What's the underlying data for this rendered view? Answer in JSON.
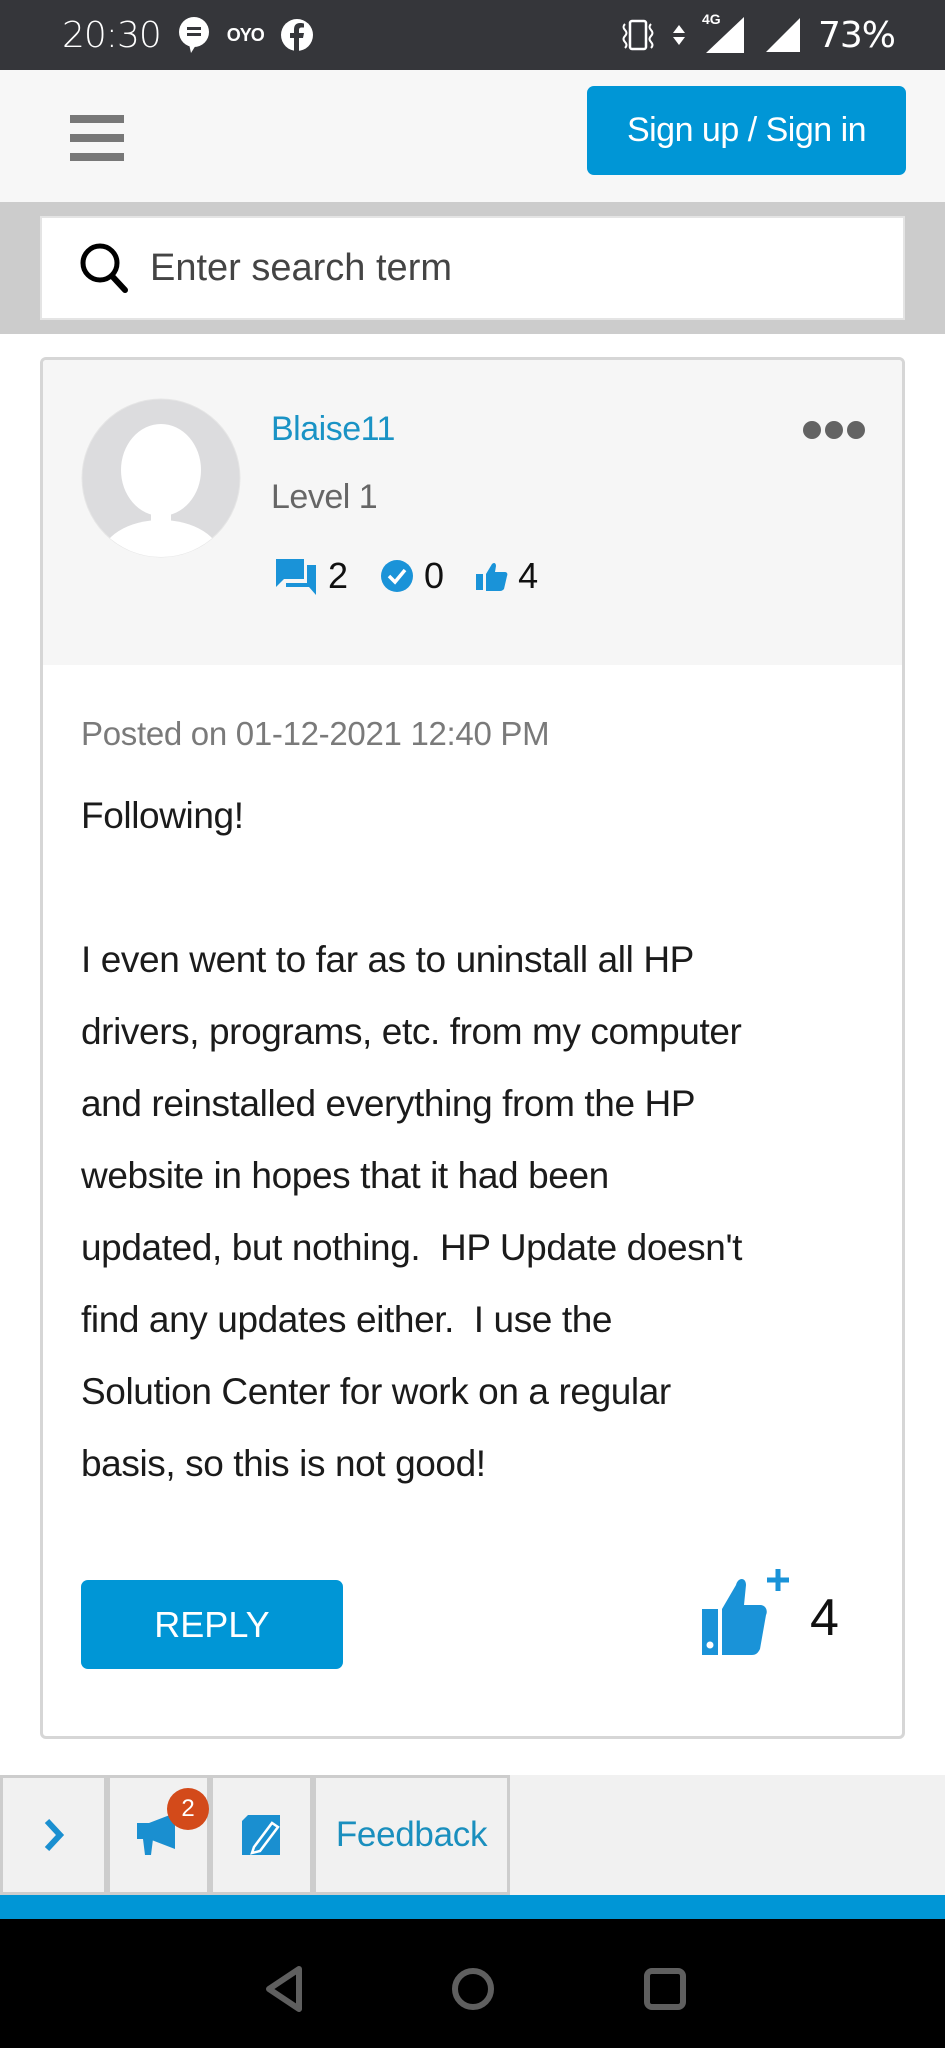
{
  "status_bar": {
    "time": "20:30",
    "notification_icons": [
      "chat-icon",
      "oyo-icon",
      "facebook-icon"
    ],
    "oyo_label": "OYO",
    "system_icons": [
      "vibrate-icon",
      "data-arrows-icon",
      "signal-4g-icon",
      "signal-icon"
    ],
    "network_label": "4G",
    "battery": "73%"
  },
  "header": {
    "menu_icon": "hamburger-icon",
    "signin_label": "Sign up / Sign in"
  },
  "search": {
    "icon": "search-icon",
    "placeholder": "Enter search term",
    "value": ""
  },
  "post": {
    "author": {
      "username": "Blaise11",
      "rank": "Level 1",
      "stats": [
        {
          "icon": "messages-icon",
          "value": "2"
        },
        {
          "icon": "solutions-icon",
          "value": "0"
        },
        {
          "icon": "kudos-icon",
          "value": "4"
        }
      ]
    },
    "menu_icon": "more-options-icon",
    "posted_on": "Posted on 01-12-2021 12:40 PM",
    "body": [
      "Following!",
      "",
      "I even went to far as to uninstall all HP",
      "drivers, programs, etc. from my computer",
      "and reinstalled everything from the HP",
      "website in hopes that it had been",
      "updated, but nothing.  HP Update doesn't",
      "find any updates either.  I use the",
      "Solution Center for work on a regular",
      "basis, so this is not good!"
    ],
    "reply_label": "REPLY",
    "kudos_count": "4"
  },
  "toolbar": {
    "expand_icon": "chevron-right-icon",
    "announcement_icon": "megaphone-icon",
    "announcement_badge": "2",
    "edit_icon": "edit-note-icon",
    "feedback_label": "Feedback"
  },
  "colors": {
    "accent": "#0096d6",
    "link": "#1a93c5",
    "badge": "#d34a1a",
    "status_bar": "#35363a"
  },
  "nav_bar": {
    "buttons": [
      "back-icon",
      "home-icon",
      "recents-icon"
    ]
  }
}
